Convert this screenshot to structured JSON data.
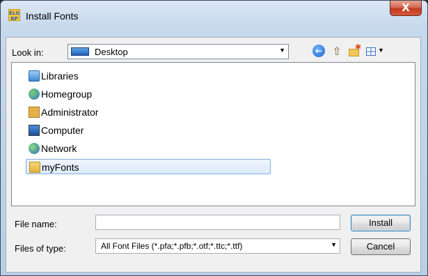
{
  "window": {
    "title": "Install Fonts",
    "app_icon_text": "ELG\nRP",
    "close_label": "X"
  },
  "toolbar": {
    "look_in_label": "Look in:",
    "look_in_value": "Desktop",
    "icons": [
      "back-icon",
      "up-folder-icon",
      "new-folder-icon",
      "view-menu-icon"
    ]
  },
  "list": {
    "items": [
      {
        "label": "Libraries",
        "icon": "libraries-icon",
        "selected": false
      },
      {
        "label": "Homegroup",
        "icon": "homegroup-icon",
        "selected": false
      },
      {
        "label": "Administrator",
        "icon": "user-folder-icon",
        "selected": false
      },
      {
        "label": "Computer",
        "icon": "computer-icon",
        "selected": false
      },
      {
        "label": "Network",
        "icon": "network-icon",
        "selected": false
      },
      {
        "label": "myFonts",
        "icon": "folder-icon",
        "selected": true
      }
    ]
  },
  "form": {
    "file_name_label": "File name:",
    "file_name_value": "",
    "file_type_label": "Files of type:",
    "file_type_value": "All Font Files (*.pfa;*.pfb;*.otf;*.ttc;*.ttf)"
  },
  "buttons": {
    "install": "Install",
    "cancel": "Cancel"
  }
}
